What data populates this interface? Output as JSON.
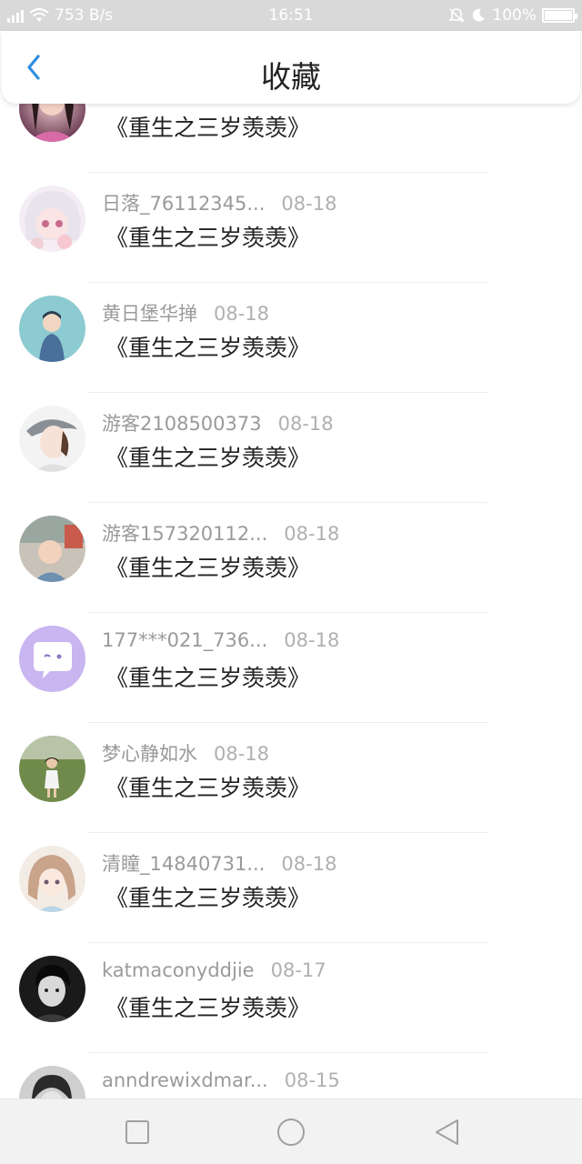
{
  "status_bar": {
    "network_speed": "753 B/s",
    "time": "16:51",
    "battery": "100%"
  },
  "header": {
    "title": "收藏"
  },
  "items": [
    {
      "name": "",
      "date": "",
      "title": "《重生之三岁羡羡》",
      "avatar": "girl-portrait"
    },
    {
      "name": "日落_76112345...",
      "date": "08-18",
      "title": "《重生之三岁羡羡》",
      "avatar": "anime-girl"
    },
    {
      "name": "黄日堡华掸",
      "date": "08-18",
      "title": "《重生之三岁羡羡》",
      "avatar": "boy-illustration"
    },
    {
      "name": "游客2108500373",
      "date": "08-18",
      "title": "《重生之三岁羡羡》",
      "avatar": "cap-boy-drawing"
    },
    {
      "name": "游客157320112...",
      "date": "08-18",
      "title": "《重生之三岁羡羡》",
      "avatar": "baby-photo"
    },
    {
      "name": "177***021_736...",
      "date": "08-18",
      "title": "《重生之三岁羡羡》",
      "avatar": "default-chat-bubble"
    },
    {
      "name": "梦心静如水",
      "date": "08-18",
      "title": "《重生之三岁羡羡》",
      "avatar": "child-in-garden"
    },
    {
      "name": "清瞳_14840731...",
      "date": "08-18",
      "title": "《重生之三岁羡羡》",
      "avatar": "anime-girl-pastel"
    },
    {
      "name": "katmaconyddjie",
      "date": "08-17",
      "title": "《重生之三岁羡羡》",
      "avatar": "bw-portrait"
    },
    {
      "name": "anndrewixdmar...",
      "date": "08-15",
      "title": "",
      "avatar": "bw-portrait-2"
    }
  ],
  "colors": {
    "accent": "#2f8fe0",
    "status_bar_bg": "#d9d9d9",
    "meta_text": "#9a9a9a",
    "title_text": "#222222"
  }
}
